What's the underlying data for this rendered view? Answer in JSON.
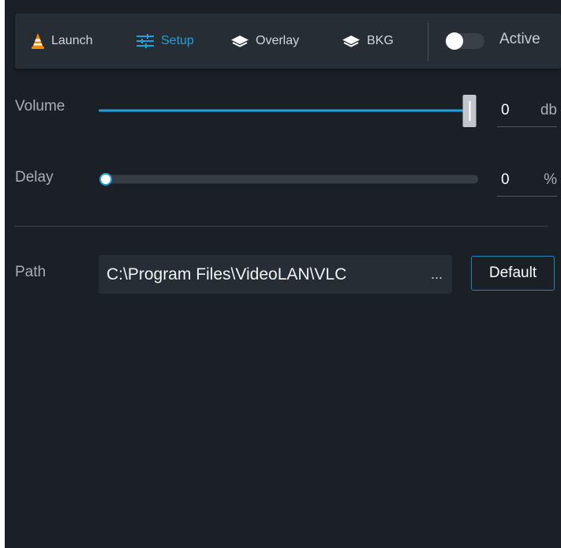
{
  "toolbar": {
    "tabs": [
      {
        "label": "Launch",
        "icon": "vlc-cone-icon"
      },
      {
        "label": "Setup",
        "icon": "sliders-icon",
        "active": true
      },
      {
        "label": "Overlay",
        "icon": "layers-icon"
      },
      {
        "label": "BKG",
        "icon": "layers-stack-icon"
      }
    ],
    "active_toggle": {
      "label": "Active",
      "on": false
    }
  },
  "settings": {
    "volume": {
      "label": "Volume",
      "value": "0",
      "unit": "db",
      "slider_level": 1.0
    },
    "delay": {
      "label": "Delay",
      "value": "0",
      "unit": "%",
      "slider_level": 0.0
    },
    "path": {
      "label": "Path",
      "value": "C:\\Program Files\\VideoLAN\\VLC",
      "browse_label": "...",
      "default_label": "Default"
    }
  },
  "colors": {
    "accent": "#1fa1dc",
    "panel_bg": "#1b2026",
    "toolbar_bg": "#272d34",
    "field_bg": "#272d34",
    "vlc_orange": "#f08a00"
  }
}
